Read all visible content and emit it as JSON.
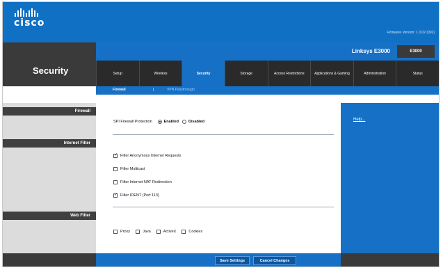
{
  "brand": {
    "logo_text": "cisco"
  },
  "firmware": "Firmware Version: 1.0.02 (002)",
  "product": {
    "name": "Linksys E3000",
    "model": "E3000"
  },
  "section_title": "Security",
  "tabs": [
    {
      "label": "Setup"
    },
    {
      "label": "Wireless"
    },
    {
      "label": "Security"
    },
    {
      "label": "Storage"
    },
    {
      "label": "Access Restrictions"
    },
    {
      "label": "Applications & Gaming"
    },
    {
      "label": "Administration"
    },
    {
      "label": "Status"
    }
  ],
  "subtabs": {
    "firewall": "Firewall",
    "separator": "|",
    "vpn": "VPN Passthrough"
  },
  "left_sections": {
    "firewall": "Firewall",
    "internet_filter": "Internet Filter",
    "web_filter": "Web Filter"
  },
  "firewall": {
    "label": "SPI Firewall Protection",
    "enabled_label": "Enabled",
    "disabled_label": "Disabled",
    "value": "Enabled"
  },
  "internet_filter": [
    {
      "label": "Filter Anonymous Internet Requests",
      "checked": true
    },
    {
      "label": "Filter Multicast",
      "checked": false
    },
    {
      "label": "Filter Internet NAT Redirection",
      "checked": false
    },
    {
      "label": "Filter IDENT (Port 113)",
      "checked": true
    }
  ],
  "web_filter": [
    {
      "label": "Proxy",
      "checked": false
    },
    {
      "label": "Java",
      "checked": false
    },
    {
      "label": "ActiveX",
      "checked": false
    },
    {
      "label": "Cookies",
      "checked": false
    }
  ],
  "help": {
    "label": "Help..."
  },
  "buttons": {
    "save": "Save Settings",
    "cancel": "Cancel Changes"
  },
  "colors": {
    "brand_blue": "#1670c6",
    "dark_gray": "#3a3a3a"
  }
}
